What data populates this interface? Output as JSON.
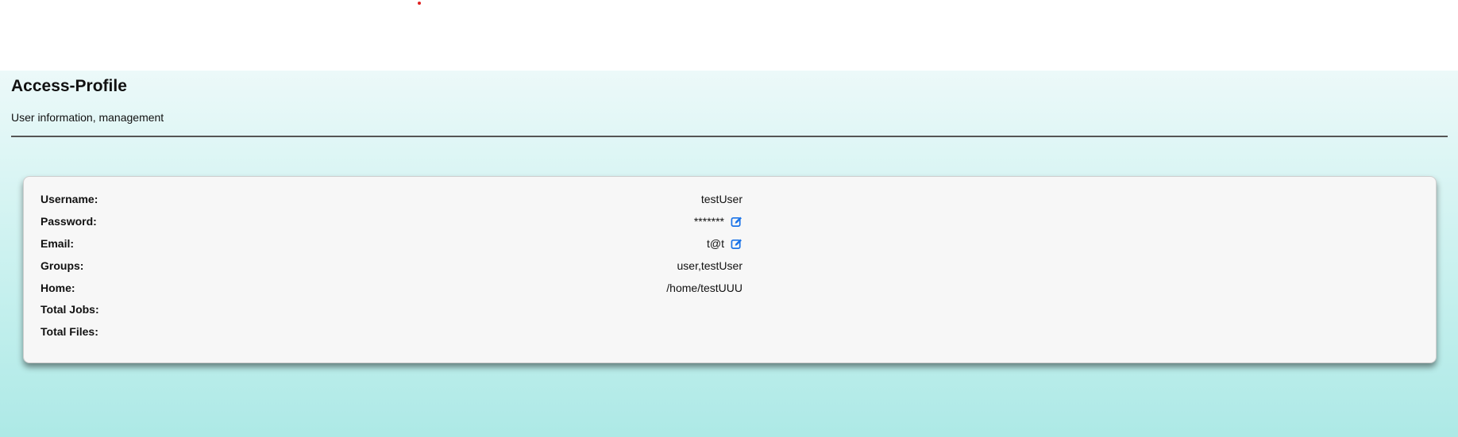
{
  "header": {
    "title": "Access-Profile",
    "subtitle": "User information, management"
  },
  "profile": {
    "rows": [
      {
        "label": "Username:",
        "value": "testUser",
        "editable": false
      },
      {
        "label": "Password:",
        "value": "*******",
        "editable": true,
        "icon": "edit-icon"
      },
      {
        "label": "Email:",
        "value": "t@t",
        "editable": true,
        "icon": "edit-icon"
      },
      {
        "label": "Groups:",
        "value": "user,testUser",
        "editable": false
      },
      {
        "label": "Home:",
        "value": "/home/testUUU",
        "editable": false
      },
      {
        "label": "Total Jobs:",
        "value": "",
        "editable": false
      },
      {
        "label": "Total Files:",
        "value": "",
        "editable": false
      }
    ]
  },
  "colors": {
    "accent_icon": "#1a73e8",
    "background_top": "#ecf9f9",
    "background_bottom": "#ade9e6",
    "card_background": "#f7f7f7"
  }
}
